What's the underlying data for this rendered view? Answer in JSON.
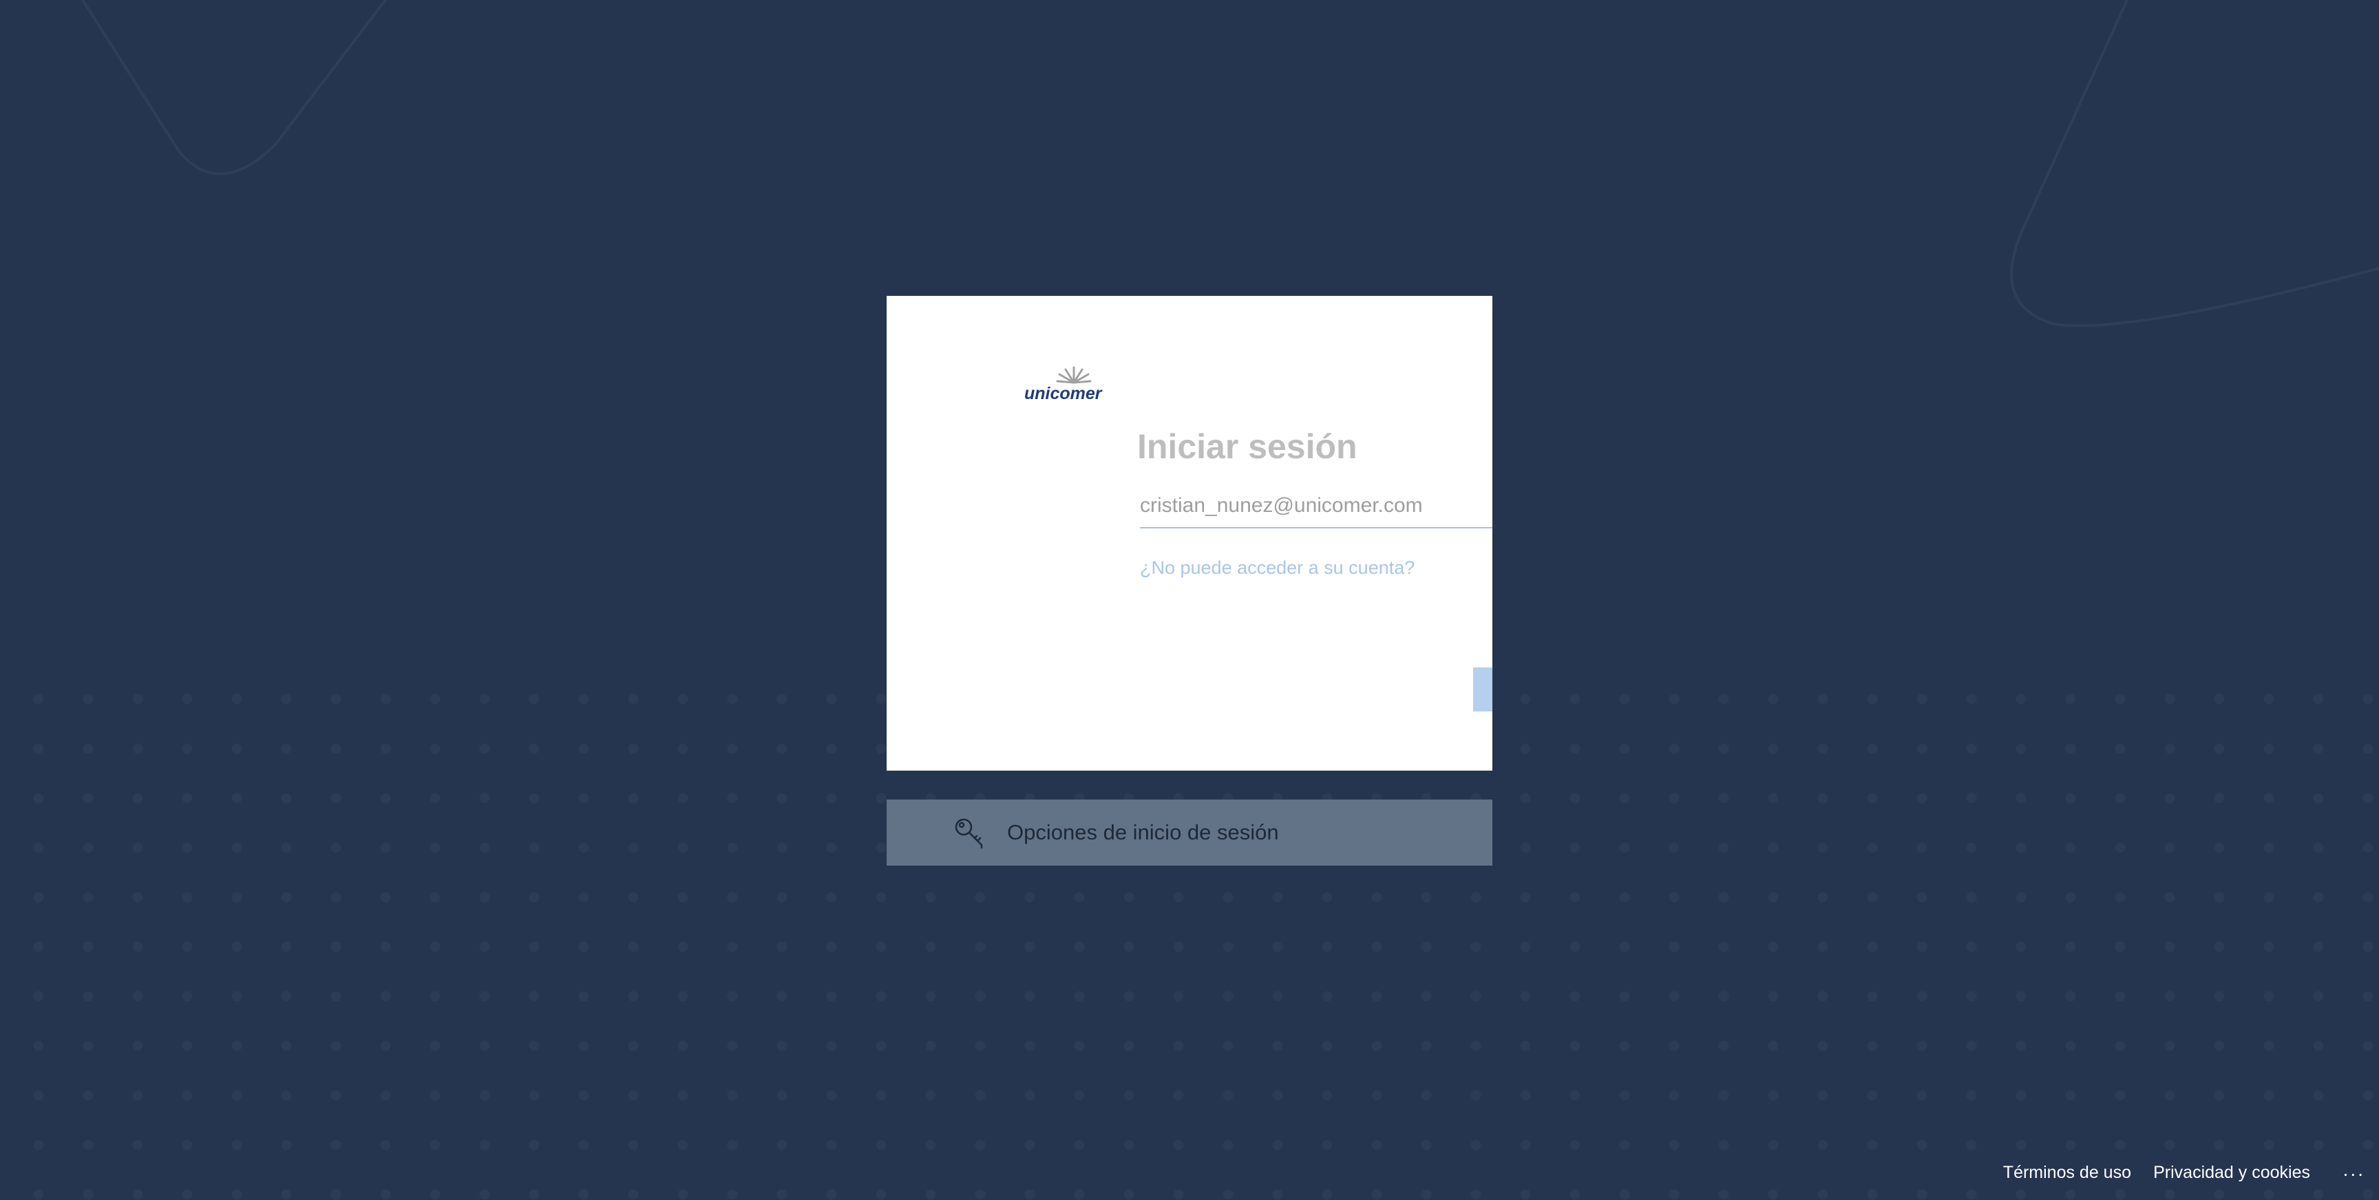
{
  "brand": {
    "logo_text": "unicomer",
    "logo_color": "#1f3c7a"
  },
  "signin": {
    "title": "Iniciar sesión",
    "email_value": "cristian_nunez@unicomer.com",
    "cant_access_link": "¿No puede acceder a su cuenta?",
    "next_button_color": "#b4d0ec"
  },
  "options": {
    "label": "Opciones de inicio de sesión",
    "icon": "key-icon"
  },
  "footer": {
    "terms": "Términos de uso",
    "privacy": "Privacidad y cookies",
    "more": "..."
  },
  "colors": {
    "background": "#25344f",
    "card": "#ffffff",
    "options_bar": "#637387"
  }
}
